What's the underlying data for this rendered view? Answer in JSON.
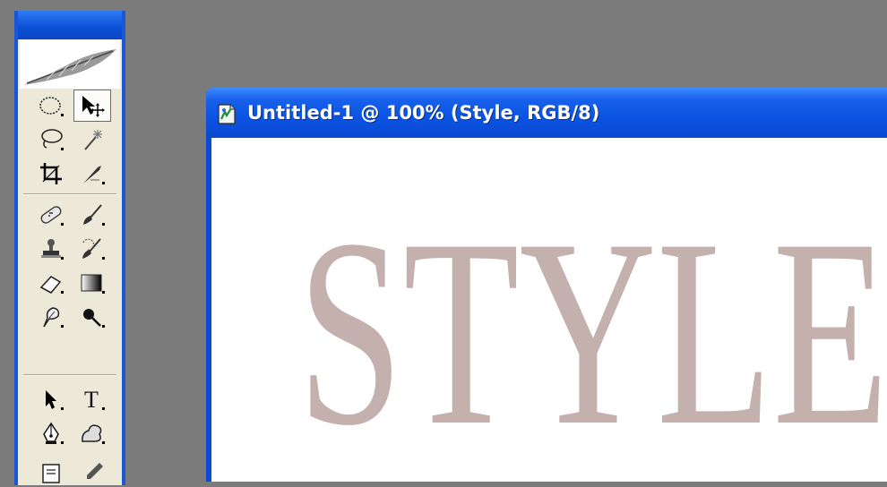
{
  "document": {
    "title": "Untitled-1 @ 100% (Style, RGB/8)",
    "canvas_text": "STYLE",
    "text_color": "#c4b0ad"
  },
  "toolbox": {
    "accent": "#1a56d8",
    "logo": "feather-icon",
    "tools": [
      [
        "elliptical-marquee-icon",
        "move-icon"
      ],
      [
        "lasso-icon",
        "magic-wand-icon"
      ],
      [
        "crop-icon",
        "slice-icon"
      ],
      [
        "healing-brush-icon",
        "brush-icon"
      ],
      [
        "clone-stamp-icon",
        "history-brush-icon"
      ],
      [
        "eraser-icon",
        "gradient-icon"
      ],
      [
        "blur-icon",
        "dodge-icon"
      ],
      [
        "path-selection-icon",
        "type-icon"
      ],
      [
        "pen-icon",
        "custom-shape-icon"
      ],
      [
        "notes-icon",
        "eyedropper-icon"
      ]
    ],
    "selected_tool": "move-icon",
    "type_tool_glyph": "T"
  }
}
